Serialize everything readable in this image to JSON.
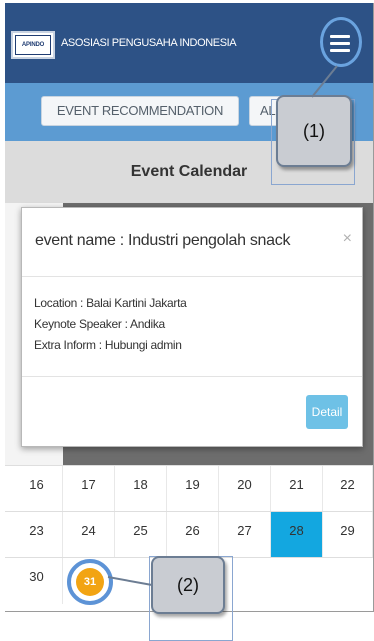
{
  "header": {
    "logo_text": "APINDO",
    "brand": "ASOSIASI PENGUSAHA INDONESIA"
  },
  "tabs": [
    {
      "label": "EVENT RECOMMENDATION"
    },
    {
      "label": "AL"
    }
  ],
  "calendar": {
    "title": "Event Calendar",
    "rows": [
      [
        "16",
        "17",
        "18",
        "19",
        "20",
        "21",
        "22"
      ],
      [
        "23",
        "24",
        "25",
        "26",
        "27",
        "28",
        "29"
      ],
      [
        "30",
        "31"
      ]
    ],
    "highlighted_day": "28",
    "today": "31"
  },
  "modal": {
    "title": "event name : Industri pengolah snack",
    "close": "×",
    "lines": [
      "Location : Balai Kartini Jakarta",
      "Keynote Speaker : Andika",
      "Extra Inform : Hubungi admin"
    ],
    "detail_button": "Detail"
  },
  "callouts": {
    "first": "(1)",
    "second": "(2)"
  },
  "colors": {
    "header": "#2d5286",
    "tabs_strip": "#5c9bd2",
    "highlight": "#13a7e0",
    "today": "#f2a413"
  },
  "icons": {
    "menu": "hamburger-menu-icon",
    "close": "close-icon"
  }
}
